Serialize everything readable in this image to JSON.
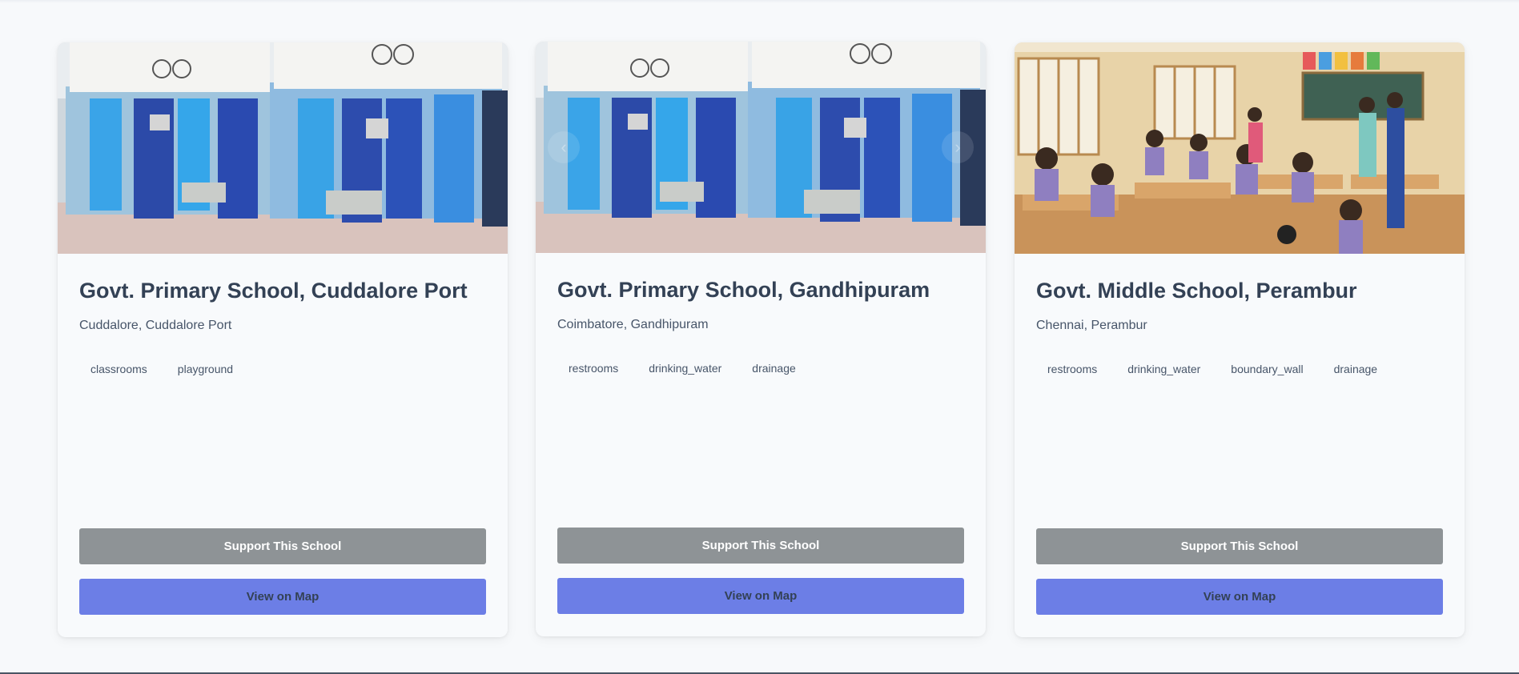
{
  "cards": [
    {
      "title": "Govt. Primary School, Cuddalore Port",
      "location": "Cuddalore, Cuddalore Port",
      "photo": "toilet-block-photo",
      "tags": [
        "classrooms",
        "playground"
      ],
      "support_label": "Support This School",
      "map_label": "View on Map"
    },
    {
      "title": "Govt. Primary School, Gandhipuram",
      "location": "Coimbatore, Gandhipuram",
      "photo": "toilet-block-photo",
      "tags": [
        "restrooms",
        "drinking_water",
        "drainage"
      ],
      "support_label": "Support This School",
      "map_label": "View on Map"
    },
    {
      "title": "Govt. Middle School, Perambur",
      "location": "Chennai, Perambur",
      "photo": "classroom-photo",
      "tags": [
        "restrooms",
        "drinking_water",
        "boundary_wall",
        "drainage"
      ],
      "support_label": "Support This School",
      "map_label": "View on Map"
    }
  ],
  "carousel": {
    "prev_icon": "‹",
    "next_icon": "›"
  },
  "colors": {
    "support_button": "#8e9396",
    "map_button": "#6c7ee6",
    "title_text": "#334155",
    "page_background": "#f7f9fb"
  }
}
